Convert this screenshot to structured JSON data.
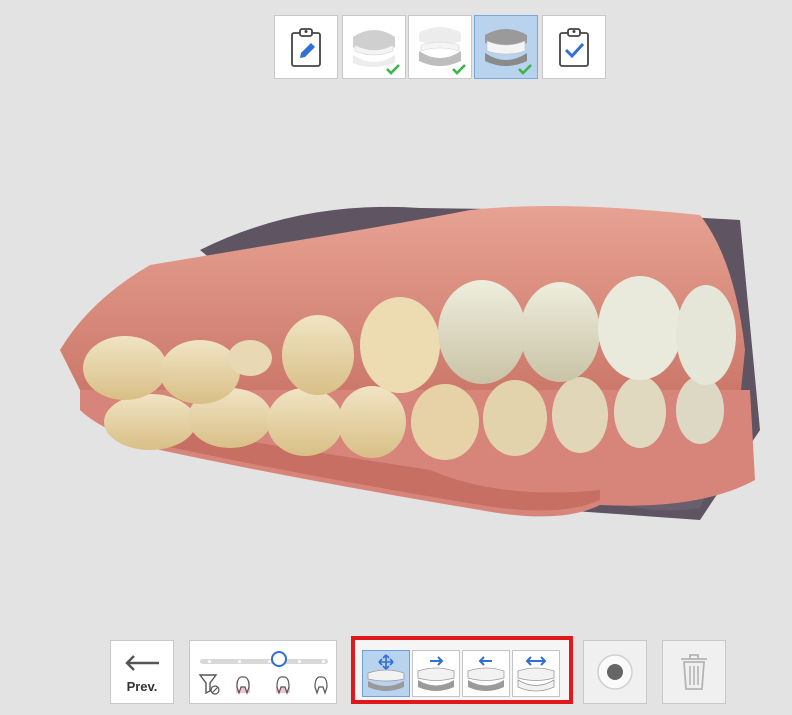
{
  "steps": [
    {
      "name": "prescription",
      "icon": "clipboard-edit-icon",
      "completed": false,
      "active": false
    },
    {
      "name": "maxilla",
      "icon": "upper-jaw-icon",
      "completed": true,
      "active": false
    },
    {
      "name": "mandible",
      "icon": "lower-jaw-icon",
      "completed": true,
      "active": false
    },
    {
      "name": "occlusion",
      "icon": "occlusion-icon",
      "completed": true,
      "active": true
    },
    {
      "name": "review",
      "icon": "clipboard-check-icon",
      "completed": false,
      "active": false
    }
  ],
  "toolbar": {
    "prev_label": "Prev.",
    "filter_slider": {
      "value_fraction": 0.62,
      "stops": 5
    }
  },
  "alignment_modes": [
    {
      "icon": "move-occlusion-icon",
      "active": true
    },
    {
      "icon": "align-right-icon",
      "active": false
    },
    {
      "icon": "align-left-icon",
      "active": false
    },
    {
      "icon": "align-both-icon",
      "active": false
    }
  ],
  "colors": {
    "background": "#e3e3e3",
    "accent_blue": "#2f6fd6",
    "active_fill": "#b9d3ee",
    "check_green": "#3bb54a",
    "highlight_red": "#e0181b",
    "gum": "#d98a7c",
    "tooth": "#e9d8b0"
  }
}
